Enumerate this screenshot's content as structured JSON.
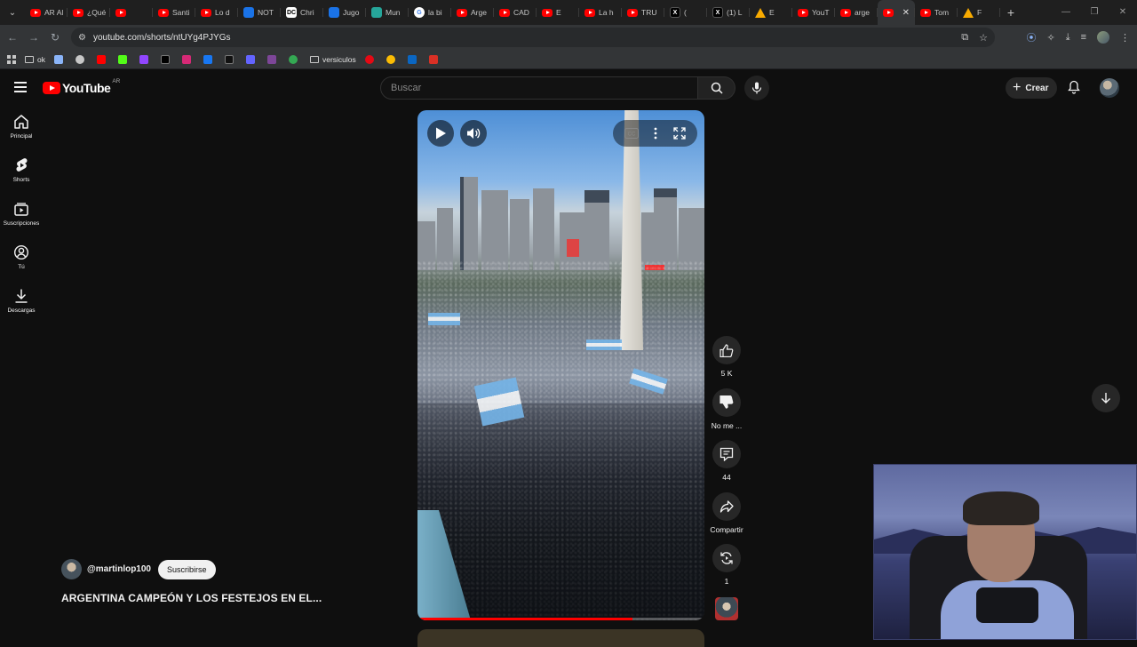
{
  "browser": {
    "tabs": [
      {
        "label": "AR Al",
        "icon": "yt"
      },
      {
        "label": "¿Qué",
        "icon": "yt"
      },
      {
        "label": "",
        "icon": "yt"
      },
      {
        "label": "Santi",
        "icon": "yt"
      },
      {
        "label": "Lo d",
        "icon": "yt"
      },
      {
        "label": "NOT",
        "icon": "blue"
      },
      {
        "label": "Chri",
        "icon": "dc"
      },
      {
        "label": "Jugo",
        "icon": "blue"
      },
      {
        "label": "Mun",
        "icon": "teal"
      },
      {
        "label": "la bi",
        "icon": "g"
      },
      {
        "label": "Arge",
        "icon": "yt"
      },
      {
        "label": "CAD",
        "icon": "yt"
      },
      {
        "label": "E",
        "icon": "yt"
      },
      {
        "label": "La h",
        "icon": "yt"
      },
      {
        "label": "TRU",
        "icon": "yt"
      },
      {
        "label": "(",
        "icon": "x"
      },
      {
        "label": "(1) L",
        "icon": "x"
      },
      {
        "label": "E",
        "icon": "warn"
      },
      {
        "label": "YouT",
        "icon": "yt"
      },
      {
        "label": "arge",
        "icon": "yt"
      },
      {
        "label": "",
        "icon": "yt",
        "active": true
      },
      {
        "label": "Tom",
        "icon": "yt"
      },
      {
        "label": "F",
        "icon": "warn"
      }
    ],
    "url": "youtube.com/shorts/ntUYg4PJYGs",
    "bookmarks": [
      {
        "label": "ok",
        "icon": "folder"
      },
      {
        "label": "",
        "icon": "gem"
      },
      {
        "label": "",
        "icon": "globe"
      },
      {
        "label": "",
        "icon": "yt"
      },
      {
        "label": "",
        "icon": "kick"
      },
      {
        "label": "",
        "icon": "twitch"
      },
      {
        "label": "",
        "icon": "x"
      },
      {
        "label": "",
        "icon": "instagram"
      },
      {
        "label": "",
        "icon": "facebook"
      },
      {
        "label": "",
        "icon": "tiktok"
      },
      {
        "label": "",
        "icon": "mastodon"
      },
      {
        "label": "",
        "icon": "tor"
      },
      {
        "label": "",
        "icon": "world"
      },
      {
        "label": "versiculos",
        "icon": "folder"
      },
      {
        "label": "",
        "icon": "netflix"
      },
      {
        "label": "",
        "icon": "chrome"
      },
      {
        "label": "",
        "icon": "ln"
      },
      {
        "label": "",
        "icon": "flag"
      }
    ]
  },
  "youtube": {
    "logo_text": "YouTube",
    "country": "AR",
    "search_placeholder": "Buscar",
    "create_label": "Crear",
    "guide": [
      {
        "label": "Principal",
        "icon": "home-icon"
      },
      {
        "label": "Shorts",
        "icon": "shorts-icon"
      },
      {
        "label": "Suscripciones",
        "icon": "subscriptions-icon"
      },
      {
        "label": "Tú",
        "icon": "you-icon"
      },
      {
        "label": "Descargas",
        "icon": "downloads-icon"
      }
    ],
    "short": {
      "channel": "@martinlop100",
      "subscribe_label": "Suscribirse",
      "title": "ARGENTINA CAMPEÓN Y LOS FESTEJOS EN EL...",
      "progress": 0.75
    },
    "actions": {
      "like_count": "5 K",
      "dislike_label": "No me ...",
      "comments_count": "44",
      "share_label": "Compartir",
      "remix_count": "1"
    }
  },
  "colors": {
    "accent": "#ff0000",
    "background": "#0f0f0f"
  }
}
